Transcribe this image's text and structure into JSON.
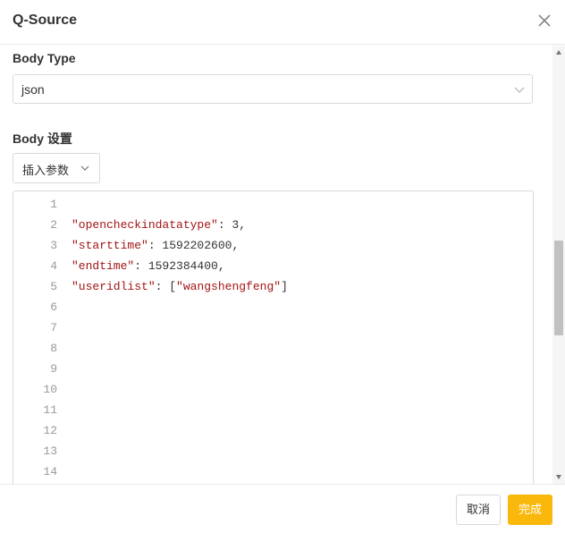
{
  "dialog": {
    "title": "Q-Source",
    "close_icon": "close-icon"
  },
  "body_type": {
    "label": "Body Type",
    "value": "json"
  },
  "body_settings": {
    "label": "Body 设置",
    "insert_button": "插入参数"
  },
  "editor": {
    "lines": [
      {
        "n": "1",
        "key": "",
        "rest": ""
      },
      {
        "n": "2",
        "key": "\"opencheckindatatype\"",
        "rest": ": 3,"
      },
      {
        "n": "3",
        "key": "\"starttime\"",
        "rest": ": 1592202600,"
      },
      {
        "n": "4",
        "key": "\"endtime\"",
        "rest": ": 1592384400,"
      },
      {
        "n": "5",
        "key": "\"useridlist\"",
        "rest": ": [",
        "str2": "\"wangshengfeng\"",
        "tail": "]"
      },
      {
        "n": "6",
        "key": "",
        "rest": ""
      },
      {
        "n": "7",
        "key": "",
        "rest": ""
      },
      {
        "n": "8",
        "key": "",
        "rest": ""
      },
      {
        "n": "9",
        "key": "",
        "rest": ""
      },
      {
        "n": "10",
        "key": "",
        "rest": ""
      },
      {
        "n": "11",
        "key": "",
        "rest": ""
      },
      {
        "n": "12",
        "key": "",
        "rest": ""
      },
      {
        "n": "13",
        "key": "",
        "rest": ""
      },
      {
        "n": "14",
        "key": "",
        "rest": ""
      }
    ]
  },
  "footer": {
    "cancel": "取消",
    "ok": "完成"
  },
  "colors": {
    "primary": "#fbb80c",
    "string": "#a31515"
  }
}
